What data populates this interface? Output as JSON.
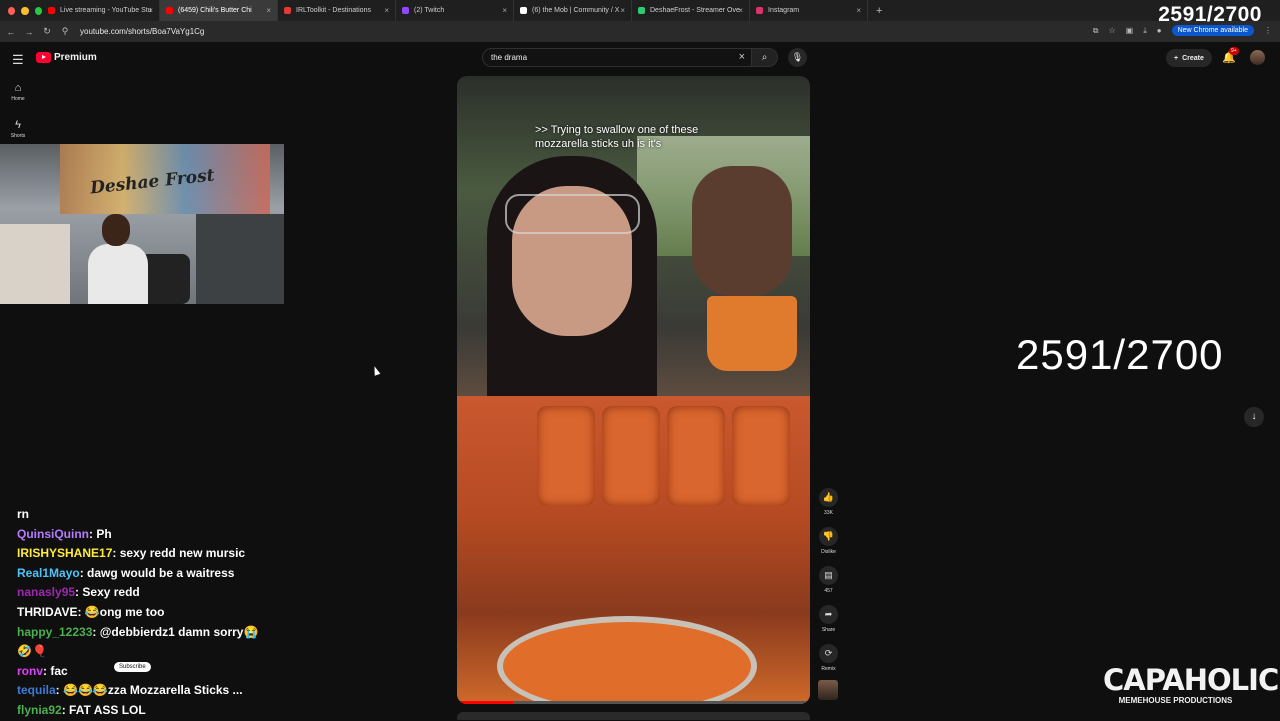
{
  "browser": {
    "tabs": [
      {
        "title": "Live streaming - YouTube Stu",
        "color": "#ff0000"
      },
      {
        "title": "(6459) Chili's Butter Chi",
        "color": "#ff0000",
        "active": true
      },
      {
        "title": "IRLToolkit - Destinations",
        "color": "#e53935"
      },
      {
        "title": "(2) Twitch",
        "color": "#9146ff"
      },
      {
        "title": "(6) the Mob | Community / X",
        "color": "#ffffff"
      },
      {
        "title": "DeshaeFrost - Streamer Ove",
        "color": "#2ecc71"
      },
      {
        "title": "Instagram",
        "color": "#e1306c"
      }
    ],
    "url": "youtube.com/shorts/Boa7VaYg1Cg",
    "update_label": "New Chrome available"
  },
  "overlay": {
    "counter_top": "2591/2700",
    "counter_big": "2591/2700",
    "brand_big": "CAPAHOLICS",
    "brand_small": "MEMEHOUSE PRODUCTIONS"
  },
  "youtube": {
    "logo_text": "Premium",
    "search_value": "the drama",
    "create_label": "Create",
    "notif_count": "9+",
    "sidebar": [
      {
        "label": "Home",
        "icon": "home-icon"
      },
      {
        "label": "Shorts",
        "icon": "shorts-icon"
      }
    ],
    "short": {
      "caption_line1": ">> Trying to swallow one of these",
      "caption_line2": "mozzarella sticks uh is it's",
      "progress": 0.16
    },
    "actions": {
      "like_count": "33K",
      "dislike_label": "Dislike",
      "comment_count": "457",
      "share_label": "Share",
      "remix_label": "Remix"
    }
  },
  "webcam": {
    "mural_text": "Deshae Frost"
  },
  "chat": [
    {
      "user": "rn",
      "message": "",
      "ucolor": "u5"
    },
    {
      "user": "QuinsiQuinn",
      "message": "Ph",
      "ucolor": "u1"
    },
    {
      "user": "IRISHYSHANE17",
      "message": "sexy redd new mursic",
      "ucolor": "u2"
    },
    {
      "user": "Real1Mayo",
      "message": "dawg would be a waitress",
      "ucolor": "u3"
    },
    {
      "user": "nanasly95",
      "message": "Sexy redd",
      "ucolor": "u4"
    },
    {
      "user": "THRIDAVE",
      "message": "😂ong me too",
      "ucolor": "u5"
    },
    {
      "user": "happy_12233",
      "message": "@debbierdz1 damn sorry😭",
      "ucolor": "u6"
    },
    {
      "user": "🤣🎈",
      "message": "",
      "ucolor": "u5"
    },
    {
      "user": "ronv",
      "message": "fac",
      "ucolor": "u7"
    },
    {
      "user": "tequila",
      "message": "😂😂😂zza Mozzarella Sticks ...",
      "ucolor": "u8"
    },
    {
      "user": "flynia92",
      "message": "FAT ASS LOL",
      "ucolor": "u6"
    }
  ],
  "subscribe_label": "Subscribe"
}
